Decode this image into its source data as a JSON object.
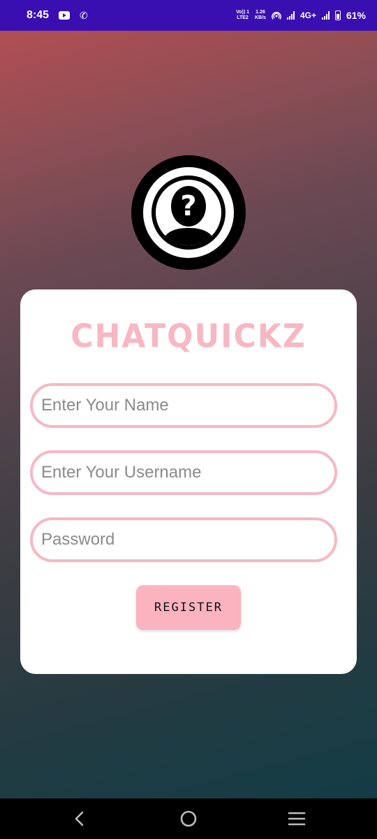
{
  "status_bar": {
    "time": "8:45",
    "volte_label_top": "Vo)) 1",
    "volte_label_bottom": "LTE2",
    "speed_top": "1.26",
    "speed_bottom": "KB/s",
    "network": "4G+",
    "battery": "61%",
    "icons": [
      "youtube-icon",
      "missed-call-icon",
      "hotspot-icon",
      "signal-icon",
      "battery-icon"
    ]
  },
  "app": {
    "title": "CHATQUICKZ",
    "accent_color": "#f7b7c3",
    "avatar_icon": "unknown-user-icon"
  },
  "form": {
    "name_placeholder": "Enter Your Name",
    "username_placeholder": "Enter Your Username",
    "password_placeholder": "Password",
    "register_label": "REGISTER"
  },
  "nav": {
    "icons": [
      "back-icon",
      "home-icon",
      "recents-icon"
    ]
  }
}
